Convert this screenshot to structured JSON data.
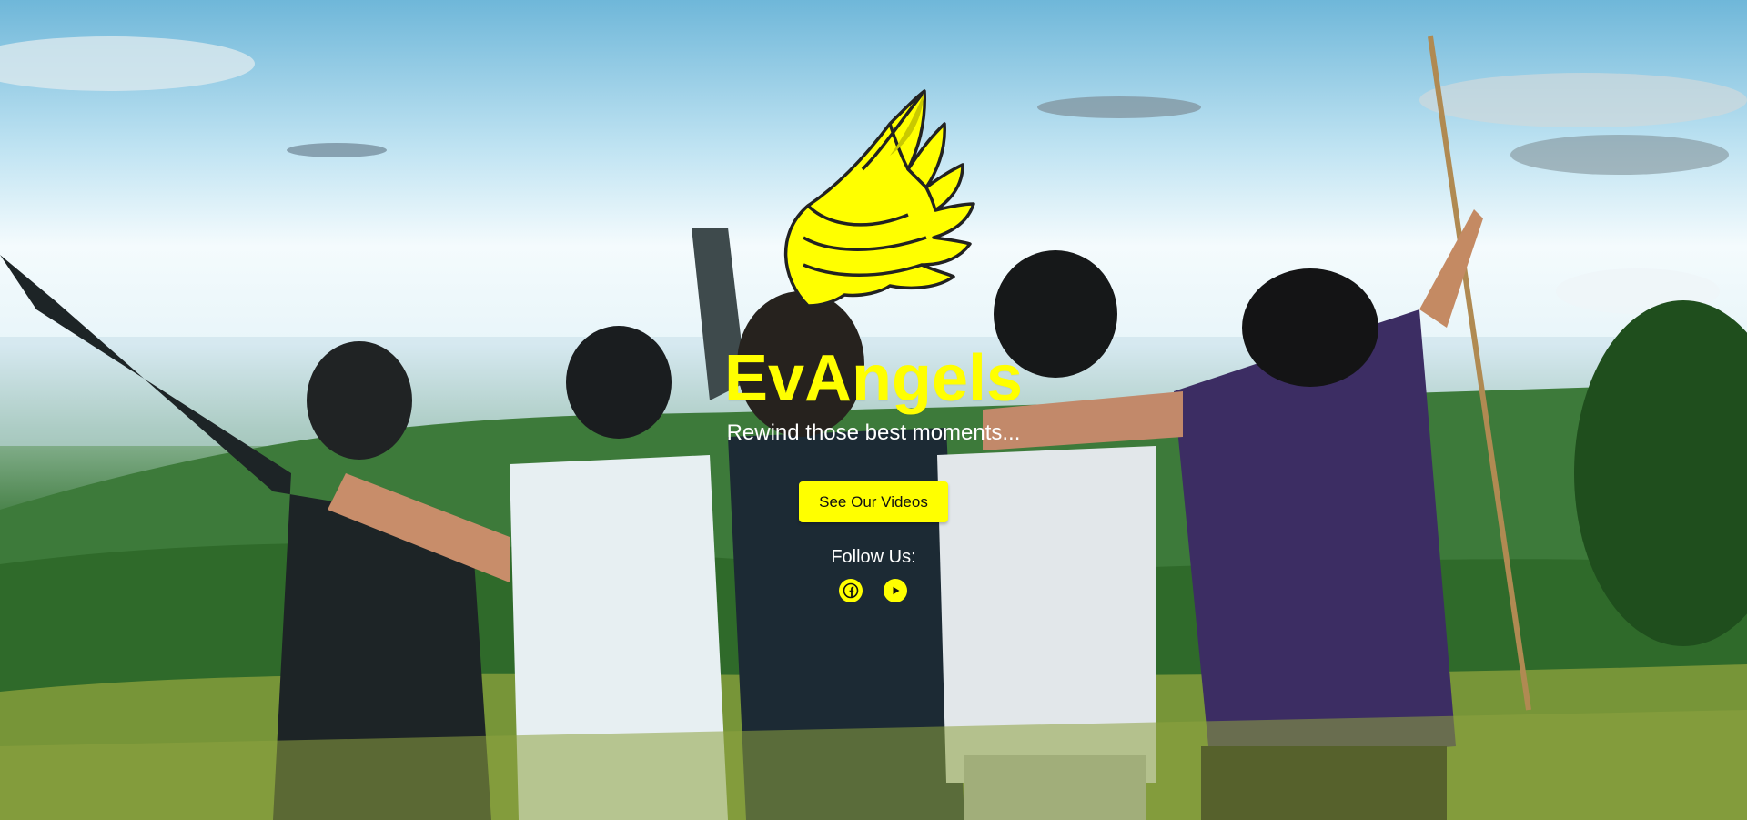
{
  "brand": {
    "title": "EvAngels",
    "tagline": "Rewind those best moments..."
  },
  "cta": {
    "label": "See Our Videos"
  },
  "social": {
    "label": "Follow Us:",
    "links": [
      {
        "name": "facebook",
        "icon": "facebook-icon"
      },
      {
        "name": "youtube",
        "icon": "youtube-play-icon"
      }
    ]
  },
  "colors": {
    "accent": "#ffff00",
    "text": "#ffffff"
  }
}
